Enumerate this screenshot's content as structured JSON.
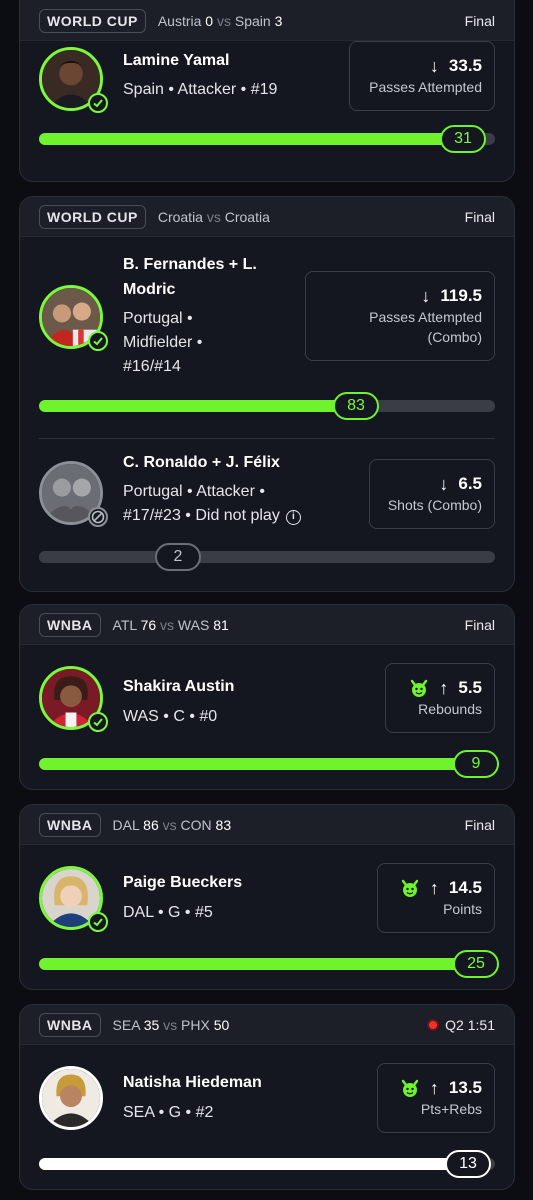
{
  "cards": [
    {
      "league": "WORLD CUP",
      "team1": "Austria",
      "score1": "0",
      "vs": "vs",
      "team2": "Spain",
      "score2": "3",
      "status": "Final",
      "players": [
        {
          "name": "Lamine Yamal",
          "info": "Spain • Attacker • #19",
          "line": "33.5",
          "stat": "Passes Attempted",
          "direction": "down",
          "result": "31",
          "progress": 0.92
        }
      ]
    },
    {
      "league": "WORLD CUP",
      "team1": "Croatia",
      "vs": "vs",
      "team2": "Croatia",
      "status": "Final",
      "players": [
        {
          "name_l1": "B. Fernandes + L.",
          "name_l2": "Modric",
          "info_l1": "Portugal •",
          "info_l2": "Midfielder •",
          "info_l3": "#16/#14",
          "line": "119.5",
          "stat_l1": "Passes Attempted",
          "stat_l2": "(Combo)",
          "direction": "down",
          "result": "83",
          "progress": 0.69
        },
        {
          "name": "C. Ronaldo + J. Félix",
          "info_l1": "Portugal • Attacker •",
          "info_l2": "#17/#23 • Did not play",
          "line": "6.5",
          "stat": "Shots (Combo)",
          "direction": "down",
          "result": "2",
          "progress": 0.31
        }
      ]
    },
    {
      "league": "WNBA",
      "team1": "ATL",
      "score1": "76",
      "vs": "vs",
      "team2": "WAS",
      "score2": "81",
      "status": "Final",
      "players": [
        {
          "name": "Shakira Austin",
          "info": "WAS • C • #0",
          "line": "5.5",
          "stat": "Rebounds",
          "direction": "up",
          "result": "9",
          "progress": 1.0
        }
      ]
    },
    {
      "league": "WNBA",
      "team1": "DAL",
      "score1": "86",
      "vs": "vs",
      "team2": "CON",
      "score2": "83",
      "status": "Final",
      "players": [
        {
          "name": "Paige Bueckers",
          "info": "DAL • G • #5",
          "line": "14.5",
          "stat": "Points",
          "direction": "up",
          "result": "25",
          "progress": 1.0
        }
      ]
    },
    {
      "league": "WNBA",
      "team1": "SEA",
      "score1": "35",
      "vs": "vs",
      "team2": "PHX",
      "score2": "50",
      "status": "Q2 1:51",
      "players": [
        {
          "name": "Natisha Hiedeman",
          "info": "SEA • G • #2",
          "line": "13.5",
          "stat": "Pts+Rebs",
          "direction": "up",
          "result": "13",
          "progress": 0.96
        }
      ]
    }
  ],
  "icons": {
    "check": "check-icon",
    "banned": "not-allowed-icon",
    "info": "info-icon",
    "devil": "devil-icon",
    "down": "arrow-down-icon",
    "up": "arrow-up-icon"
  },
  "colors": {
    "accent": "#6ff32c",
    "live": "#ff2d2d",
    "card": "#14171f",
    "background": "#0b0d12"
  }
}
